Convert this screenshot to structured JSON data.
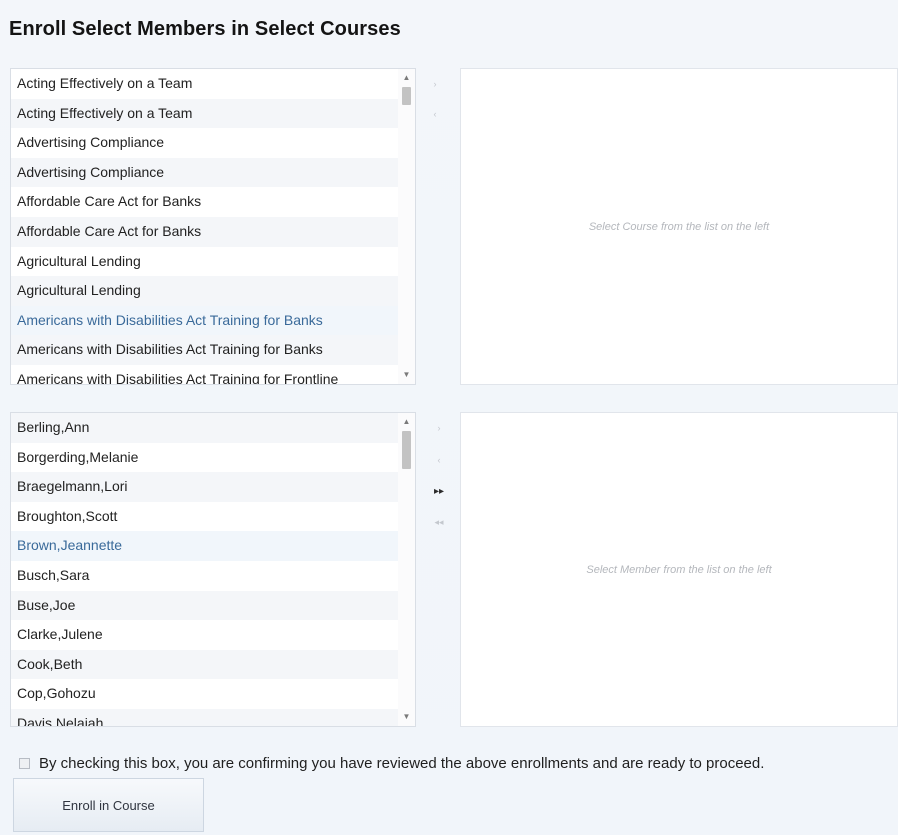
{
  "page": {
    "title": "Enroll Select Members in Select Courses"
  },
  "courses": {
    "items": [
      "Acting Effectively on a Team",
      "Acting Effectively on a Team",
      "Advertising Compliance",
      "Advertising Compliance",
      "Affordable Care Act for Banks",
      "Affordable Care Act for Banks",
      "Agricultural Lending",
      "Agricultural Lending",
      "Americans with Disabilities Act Training for Banks",
      "Americans with Disabilities Act Training for Banks",
      "Americans with Disabilities Act Training for Frontline"
    ],
    "panel_hint": "Select Course from the list on the left"
  },
  "members": {
    "items": [
      "Berling,Ann",
      "Borgerding,Melanie",
      "Braegelmann,Lori",
      "Broughton,Scott",
      "Brown,Jeannette",
      "Busch,Sara",
      "Buse,Joe",
      "Clarke,Julene",
      "Cook,Beth",
      "Cop,Gohozu",
      "Davis,Nelaiah"
    ],
    "panel_hint": "Select Member from the list on the left"
  },
  "icons": {
    "scroll_up": "▲",
    "scroll_down": "▼",
    "move_right": "›",
    "move_left": "‹",
    "move_all_right": "▸▸",
    "move_all_left": "◂◂"
  },
  "confirm": {
    "label": "By checking this box, you are confirming you have reviewed the above enrollments and are ready to proceed."
  },
  "actions": {
    "enroll_label": "Enroll in Course"
  }
}
